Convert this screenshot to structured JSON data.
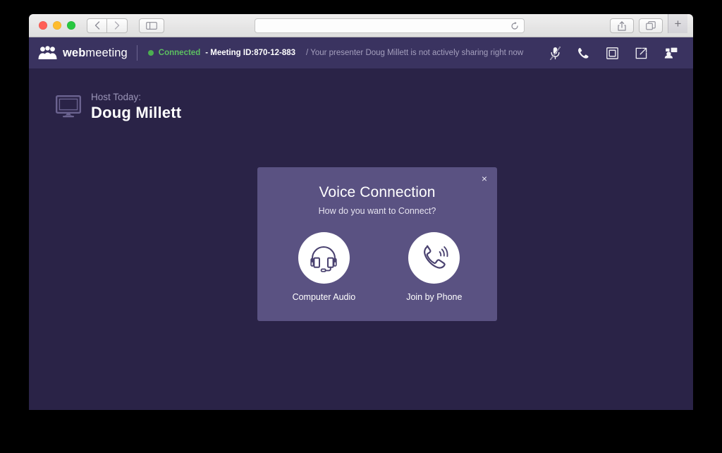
{
  "browser": {
    "nav": {
      "back_icon": "chevron-left-icon",
      "forward_icon": "chevron-right-icon",
      "sidebar_icon": "sidebar-toggle-icon"
    },
    "url_bar": {
      "value": "",
      "placeholder": "",
      "reload_icon": "reload-icon"
    },
    "actions": {
      "share_icon": "share-icon",
      "tabs_icon": "show-tabs-icon",
      "new_tab_label": "+"
    },
    "traffic_lights": {
      "close": "close-window-button",
      "minimize": "minimize-window-button",
      "zoom": "zoom-window-button"
    }
  },
  "header": {
    "logo": {
      "bold_part": "web",
      "light_part": "meeting",
      "icon": "people-group-icon"
    },
    "status": {
      "dot_color": "#4caf50",
      "connected_label": "Connected",
      "meeting_label": "- Meeting ID:870-12-883",
      "note": "/ Your presenter Doug Millett is not actively sharing right now"
    },
    "icons": [
      {
        "name": "microphone-muted-icon",
        "label": "Mute"
      },
      {
        "name": "phone-icon",
        "label": "Phone"
      },
      {
        "name": "screen-share-icon",
        "label": "Screen"
      },
      {
        "name": "open-external-icon",
        "label": "Share"
      },
      {
        "name": "participants-icon",
        "label": "Participants"
      }
    ]
  },
  "stage": {
    "host": {
      "icon": "monitor-icon",
      "label": "Host Today:",
      "name": "Doug Millett"
    }
  },
  "modal": {
    "title": "Voice Connection",
    "subtitle": "How do you want to Connect?",
    "close_label": "×",
    "options": [
      {
        "label": "Computer Audio",
        "icon": "headset-icon"
      },
      {
        "label": "Join by Phone",
        "icon": "phone-ringing-icon"
      }
    ]
  },
  "colors": {
    "page_background": "#000000",
    "app_header": "#3a3360",
    "stage_background": "#2a2347",
    "modal_background": "#5a5282",
    "accent_green": "#5cbf60",
    "muted_text": "#a49fbd"
  }
}
